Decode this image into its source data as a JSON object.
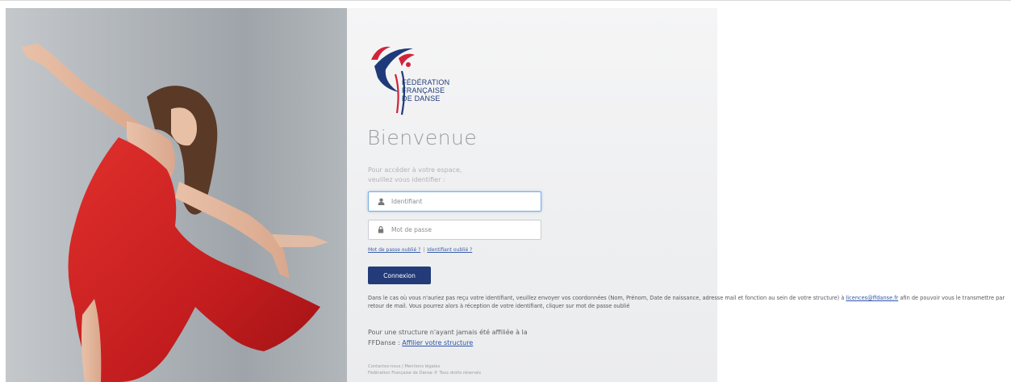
{
  "hero": {
    "image": "dancer-in-red-dress"
  },
  "logo": {
    "line1": "FÉDÉRATION",
    "line2": "FRANÇAISE",
    "line3": "DE DANSE",
    "colors": {
      "blue": "#1f3a7a",
      "red": "#d1243a"
    }
  },
  "login": {
    "title": "Bienvenue",
    "intro_line1": "Pour accéder à votre espace,",
    "intro_line2": "veuillez vous identifier :",
    "identifier_placeholder": "Identifiant",
    "password_placeholder": "Mot de passe",
    "forgot_password": "Mot de passe oublié ?",
    "links_separator": "|",
    "forgot_identifier": "Identifiant oublié ?",
    "submit_label": "Connexion",
    "accent_color": "#233b78"
  },
  "info": {
    "text_before": "Dans le cas où vous n'auriez pas reçu votre identifiant, veuillez envoyer vos coordonnées (Nom, Prénom, Date de naissance, adresse mail et fonction au sein de votre structure) à ",
    "email": "licences@ffdanse.fr",
    "text_after": " afin de pouvoir vous le transmettre par retour de mail. Vous pourrez alors à réception de votre identifiant, cliquer sur mot de passe oublié"
  },
  "affiliation": {
    "text": "Pour une structure n'ayant jamais été affiliée à la FFDanse : ",
    "link": "Affilier votre structure"
  },
  "footer": {
    "contact": "Contactez-nous",
    "separator": "|",
    "legal": "Mentions légales",
    "copyright": "Fédération Française de Danse © Tous droits réservés"
  }
}
